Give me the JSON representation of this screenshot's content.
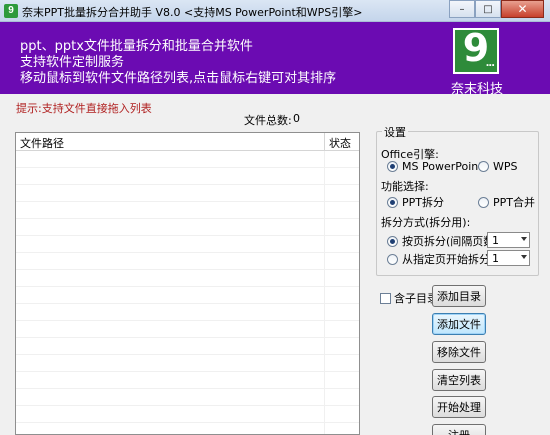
{
  "window": {
    "title": "奈末PPT批量拆分合并助手 V8.0 <支持MS PowerPoint和WPS引擎>",
    "app_icon": "9",
    "minimize": "–",
    "maximize": "□",
    "close": "✕"
  },
  "banner": {
    "lines": [
      "ppt、pptx文件批量拆分和批量合并软件",
      "支持软件定制服务",
      "移动鼠标到软件文件路径列表,点击鼠标右键可对其排序"
    ],
    "logo_text": "9",
    "logo_dots": "...",
    "company": "奈末科技",
    "color": "#6b0bb2"
  },
  "hint": "提示:支持文件直接拖入列表",
  "file_count": {
    "label": "文件总数:",
    "value": "0"
  },
  "list": {
    "columns": [
      "文件路径",
      "状态"
    ]
  },
  "settings": {
    "title": "设置",
    "engine_label": "Office引擎:",
    "engine_options": [
      {
        "label": "MS PowerPoint",
        "checked": true
      },
      {
        "label": "WPS",
        "checked": false
      }
    ],
    "function_label": "功能选择:",
    "function_options": [
      {
        "label": "PPT拆分",
        "checked": true
      },
      {
        "label": "PPT合并",
        "checked": false
      }
    ],
    "split_label": "拆分方式(拆分用):",
    "split_options": [
      {
        "label": "按页拆分(间隔页数)",
        "checked": true,
        "select_value": "1"
      },
      {
        "label": "从指定页开始拆分",
        "checked": false,
        "select_value": "1"
      }
    ]
  },
  "include_subdir": {
    "label": "含子目录",
    "checked": false
  },
  "buttons": {
    "add_dir": "添加目录",
    "add_file": "添加文件",
    "remove_file": "移除文件",
    "clear_list": "清空列表",
    "start": "开始处理",
    "register": "注册"
  }
}
